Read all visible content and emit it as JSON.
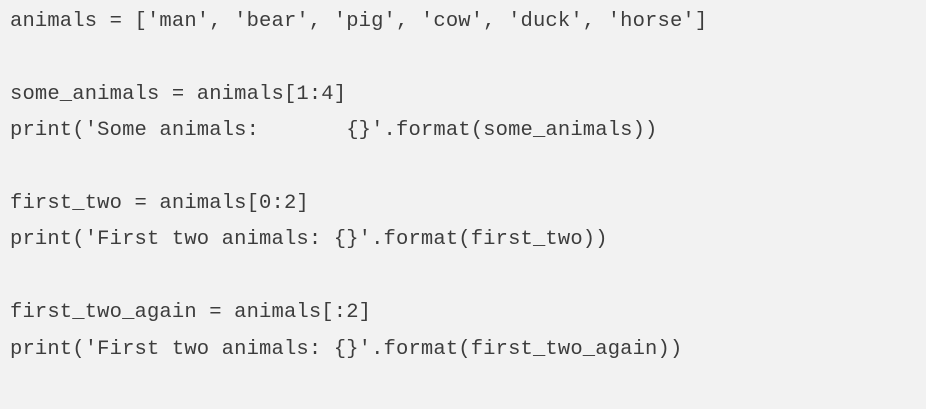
{
  "code": {
    "lines": [
      "animals = ['man', 'bear', 'pig', 'cow', 'duck', 'horse']",
      "",
      "some_animals = animals[1:4]",
      "print('Some animals:       {}'.format(some_animals))",
      "",
      "first_two = animals[0:2]",
      "print('First two animals: {}'.format(first_two))",
      "",
      "first_two_again = animals[:2]",
      "print('First two animals: {}'.format(first_two_again))"
    ]
  }
}
